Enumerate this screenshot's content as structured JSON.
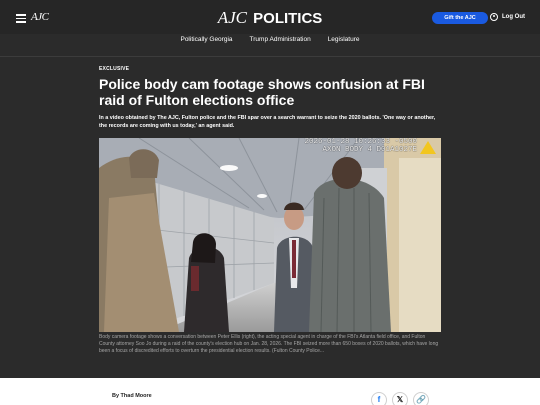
{
  "header": {
    "small_logo": "AJC",
    "brand_ajc": "AJC",
    "brand_section": "POLITICS",
    "gift_label": "Gift the AJC",
    "logout_label": "Log Out"
  },
  "nav": {
    "items": [
      {
        "label": "Politically Georgia"
      },
      {
        "label": "Trump Administration"
      },
      {
        "label": "Legislature"
      }
    ]
  },
  "article": {
    "kicker": "EXCLUSIVE",
    "headline": "Police body cam footage shows confusion at FBI raid of Fulton elections office",
    "dek": "In a video obtained by The AJC, Fulton police and the FBI spar over a search warrant to seize the 2020 ballots. 'One way or another, the records are coming with us today,' an agent said.",
    "photo": {
      "timestamp": "2026-01-28 10:26:33 -0500",
      "camera_id": "AXON BODY 4 D01A1027E"
    },
    "caption": "Body camera footage shows a conversation between Peter Ellis (right), the acting special agent in charge of the FBI's Atlanta field office, and Fulton County attorney Soo Jo during a raid of the county's election hub on Jan. 28, 2026. The FBI seized more than 650 boxes of 2020 ballots, which have long been a focus of discredited efforts to overturn the presidential election results. (Fulton County Police...",
    "byline": "By Thad Moore"
  },
  "share": {
    "facebook": "f",
    "x": "𝕏",
    "link": "🔗"
  }
}
